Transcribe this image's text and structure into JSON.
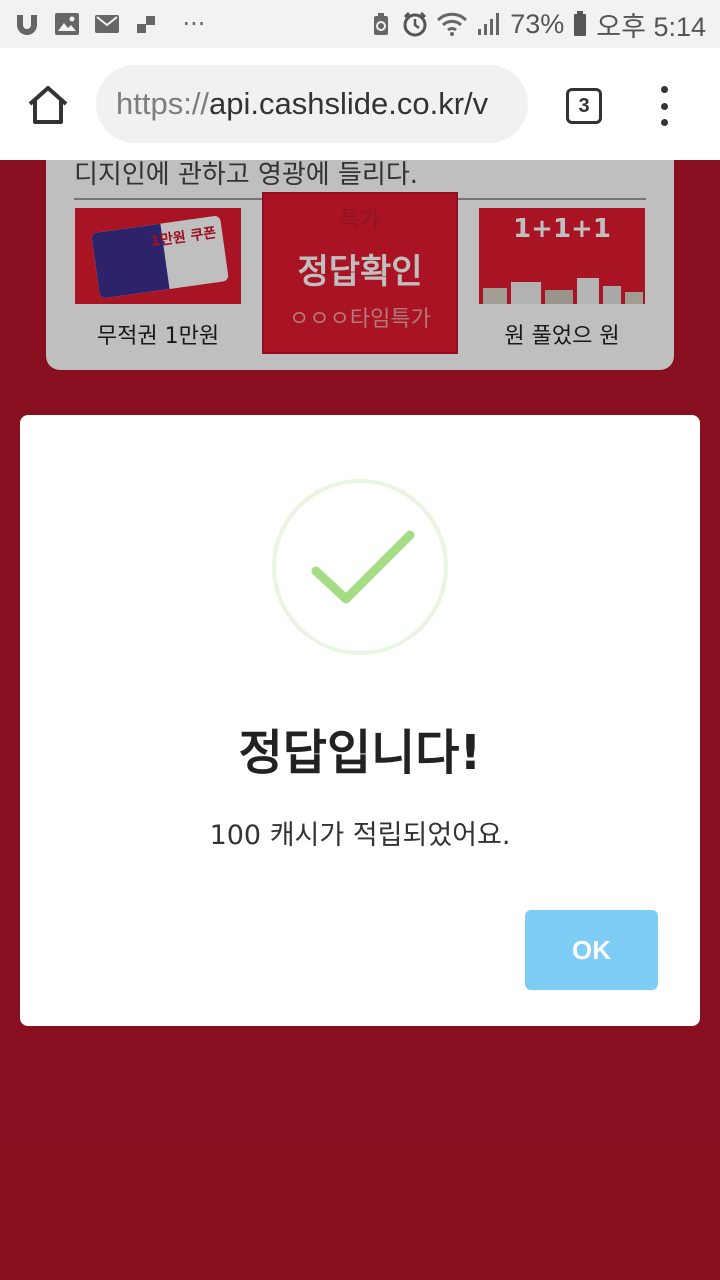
{
  "status_bar": {
    "more_icons": "···",
    "battery_percent": "73%",
    "time": "오후 5:14",
    "icons": [
      "u-plus-icon",
      "gallery-icon",
      "mail-icon",
      "app-icon",
      "recycle-icon",
      "alarm-icon",
      "wifi-icon",
      "signal-icon",
      "battery-icon"
    ]
  },
  "browser": {
    "url_protocol": "https://",
    "url_host": "api.cashslide.co.kr/v",
    "tab_count": "3"
  },
  "background_page": {
    "banner_text": "디지인에 관하고 영광에 들리다.",
    "products": [
      {
        "label": "무적권 1만원",
        "image_text": "1만원 쿠폰"
      },
      {
        "label": "ㅇㅇㅇ타임특가",
        "image_sub": "특가",
        "image_text": "정답확인"
      },
      {
        "label": "원 풀었으 원",
        "image_text": "1+1+1"
      }
    ]
  },
  "dialog": {
    "title": "정답입니다!",
    "message": "100 캐시가 적립되었어요.",
    "ok_label": "OK"
  },
  "colors": {
    "page_bg": "#b5152a",
    "ok_button": "#7ecdf4",
    "check_green": "#a5dc86"
  }
}
